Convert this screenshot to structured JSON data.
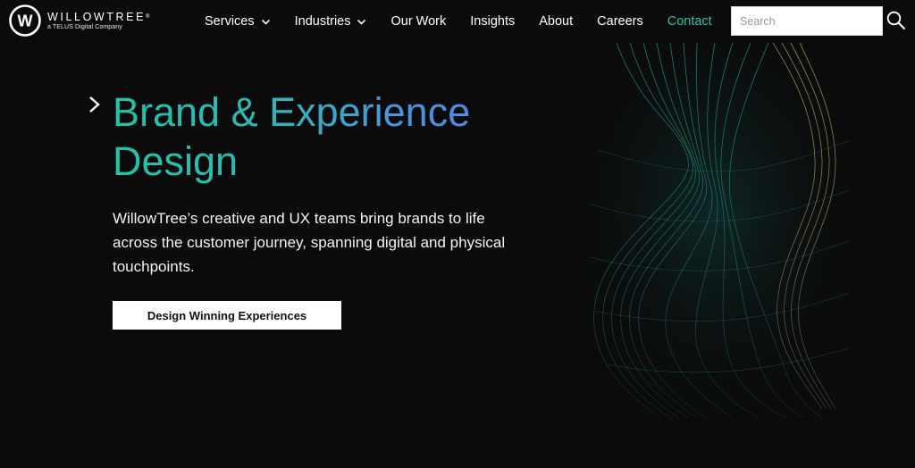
{
  "brand": {
    "name": "WILLOWTREE",
    "registered": "®",
    "tagline": "a TELUS Digital Company",
    "logo_letter": "W"
  },
  "nav": {
    "services": "Services",
    "industries": "Industries",
    "our_work": "Our Work",
    "insights": "Insights",
    "about": "About",
    "careers": "Careers",
    "contact": "Contact"
  },
  "search": {
    "placeholder": "Search",
    "value": ""
  },
  "hero": {
    "title": "Brand & Experience Design",
    "body": "WillowTree’s creative and UX teams bring brands to life across the customer journey, spanning digital and physical touchpoints.",
    "cta_label": "Design Winning Experiences"
  },
  "colors": {
    "background": "#0b0b0b",
    "accent_teal": "#2fc3a6",
    "gradient_blue": "#5a7fe8",
    "button_bg": "#ffffff"
  },
  "icons": {
    "logo": "willowtree-logo-icon",
    "chevron": "chevron-down-icon",
    "hero_arrow": "chevron-right-icon",
    "search": "search-icon"
  }
}
